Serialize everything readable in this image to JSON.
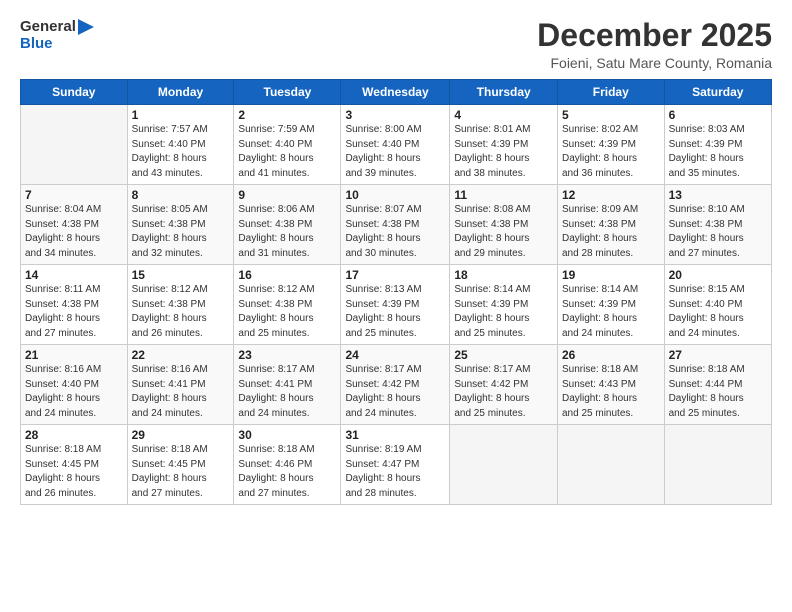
{
  "header": {
    "logo_line1": "General",
    "logo_line2": "Blue",
    "title": "December 2025",
    "subtitle": "Foieni, Satu Mare County, Romania"
  },
  "days_of_week": [
    "Sunday",
    "Monday",
    "Tuesday",
    "Wednesday",
    "Thursday",
    "Friday",
    "Saturday"
  ],
  "weeks": [
    [
      {
        "day": "",
        "info": ""
      },
      {
        "day": "1",
        "info": "Sunrise: 7:57 AM\nSunset: 4:40 PM\nDaylight: 8 hours\nand 43 minutes."
      },
      {
        "day": "2",
        "info": "Sunrise: 7:59 AM\nSunset: 4:40 PM\nDaylight: 8 hours\nand 41 minutes."
      },
      {
        "day": "3",
        "info": "Sunrise: 8:00 AM\nSunset: 4:40 PM\nDaylight: 8 hours\nand 39 minutes."
      },
      {
        "day": "4",
        "info": "Sunrise: 8:01 AM\nSunset: 4:39 PM\nDaylight: 8 hours\nand 38 minutes."
      },
      {
        "day": "5",
        "info": "Sunrise: 8:02 AM\nSunset: 4:39 PM\nDaylight: 8 hours\nand 36 minutes."
      },
      {
        "day": "6",
        "info": "Sunrise: 8:03 AM\nSunset: 4:39 PM\nDaylight: 8 hours\nand 35 minutes."
      }
    ],
    [
      {
        "day": "7",
        "info": "Sunrise: 8:04 AM\nSunset: 4:38 PM\nDaylight: 8 hours\nand 34 minutes."
      },
      {
        "day": "8",
        "info": "Sunrise: 8:05 AM\nSunset: 4:38 PM\nDaylight: 8 hours\nand 32 minutes."
      },
      {
        "day": "9",
        "info": "Sunrise: 8:06 AM\nSunset: 4:38 PM\nDaylight: 8 hours\nand 31 minutes."
      },
      {
        "day": "10",
        "info": "Sunrise: 8:07 AM\nSunset: 4:38 PM\nDaylight: 8 hours\nand 30 minutes."
      },
      {
        "day": "11",
        "info": "Sunrise: 8:08 AM\nSunset: 4:38 PM\nDaylight: 8 hours\nand 29 minutes."
      },
      {
        "day": "12",
        "info": "Sunrise: 8:09 AM\nSunset: 4:38 PM\nDaylight: 8 hours\nand 28 minutes."
      },
      {
        "day": "13",
        "info": "Sunrise: 8:10 AM\nSunset: 4:38 PM\nDaylight: 8 hours\nand 27 minutes."
      }
    ],
    [
      {
        "day": "14",
        "info": "Sunrise: 8:11 AM\nSunset: 4:38 PM\nDaylight: 8 hours\nand 27 minutes."
      },
      {
        "day": "15",
        "info": "Sunrise: 8:12 AM\nSunset: 4:38 PM\nDaylight: 8 hours\nand 26 minutes."
      },
      {
        "day": "16",
        "info": "Sunrise: 8:12 AM\nSunset: 4:38 PM\nDaylight: 8 hours\nand 25 minutes."
      },
      {
        "day": "17",
        "info": "Sunrise: 8:13 AM\nSunset: 4:39 PM\nDaylight: 8 hours\nand 25 minutes."
      },
      {
        "day": "18",
        "info": "Sunrise: 8:14 AM\nSunset: 4:39 PM\nDaylight: 8 hours\nand 25 minutes."
      },
      {
        "day": "19",
        "info": "Sunrise: 8:14 AM\nSunset: 4:39 PM\nDaylight: 8 hours\nand 24 minutes."
      },
      {
        "day": "20",
        "info": "Sunrise: 8:15 AM\nSunset: 4:40 PM\nDaylight: 8 hours\nand 24 minutes."
      }
    ],
    [
      {
        "day": "21",
        "info": "Sunrise: 8:16 AM\nSunset: 4:40 PM\nDaylight: 8 hours\nand 24 minutes."
      },
      {
        "day": "22",
        "info": "Sunrise: 8:16 AM\nSunset: 4:41 PM\nDaylight: 8 hours\nand 24 minutes."
      },
      {
        "day": "23",
        "info": "Sunrise: 8:17 AM\nSunset: 4:41 PM\nDaylight: 8 hours\nand 24 minutes."
      },
      {
        "day": "24",
        "info": "Sunrise: 8:17 AM\nSunset: 4:42 PM\nDaylight: 8 hours\nand 24 minutes."
      },
      {
        "day": "25",
        "info": "Sunrise: 8:17 AM\nSunset: 4:42 PM\nDaylight: 8 hours\nand 25 minutes."
      },
      {
        "day": "26",
        "info": "Sunrise: 8:18 AM\nSunset: 4:43 PM\nDaylight: 8 hours\nand 25 minutes."
      },
      {
        "day": "27",
        "info": "Sunrise: 8:18 AM\nSunset: 4:44 PM\nDaylight: 8 hours\nand 25 minutes."
      }
    ],
    [
      {
        "day": "28",
        "info": "Sunrise: 8:18 AM\nSunset: 4:45 PM\nDaylight: 8 hours\nand 26 minutes."
      },
      {
        "day": "29",
        "info": "Sunrise: 8:18 AM\nSunset: 4:45 PM\nDaylight: 8 hours\nand 27 minutes."
      },
      {
        "day": "30",
        "info": "Sunrise: 8:18 AM\nSunset: 4:46 PM\nDaylight: 8 hours\nand 27 minutes."
      },
      {
        "day": "31",
        "info": "Sunrise: 8:19 AM\nSunset: 4:47 PM\nDaylight: 8 hours\nand 28 minutes."
      },
      {
        "day": "",
        "info": ""
      },
      {
        "day": "",
        "info": ""
      },
      {
        "day": "",
        "info": ""
      }
    ]
  ]
}
